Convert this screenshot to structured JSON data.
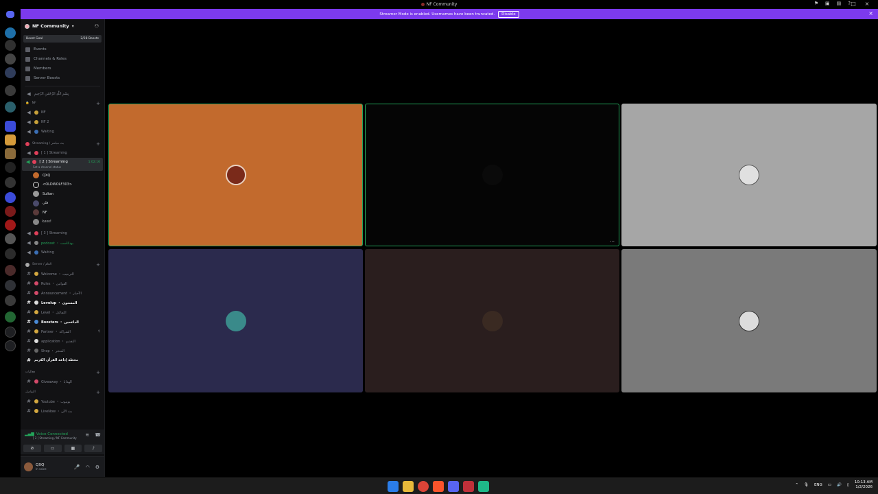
{
  "window": {
    "title": "NF Community"
  },
  "banner": {
    "message": "Streamer Mode is enabled. Usernames have been truncated.",
    "disable_label": "Disable"
  },
  "server": {
    "name": "NF Community",
    "boost_goal": "Boost Goal",
    "boost_count": "2/28 Boosts"
  },
  "menu": [
    "Events",
    "Channels & Roles",
    "Members",
    "Server Boosts"
  ],
  "channels": {
    "top_channel": "بِسْمِ اللَّهِ الرَّحْمَٰنِ الرَّحِيمِ",
    "cat_nf": "NF",
    "nf": "NF",
    "nf2": "NF 2",
    "waiting1": "Waiting",
    "cat_streaming": "Streaming / بث مباشر",
    "streaming1": "[ 1 ] Streaming",
    "streaming2": "[ 2 ] Streaming",
    "streaming2_timer": "1:02:16",
    "streaming2_status": "Set a channel status",
    "streaming3": "[ 3 ] Streaming",
    "podcast": "podcast ・ بودكاست",
    "waiting2": "Waiting",
    "cat_server": "Server / العام",
    "welcome": "Welcome ・ الترحيب",
    "rules": "Rules ・ القوانين",
    "announcement": "Announcement ・ الأخبار",
    "levelup": "Levelup ・ المستوى",
    "level": "Level ・ التفاعل",
    "boosters": "Boosters ・ الداعمين",
    "partner": "Partner ・ الشراكة",
    "application": "application ・ التقديم",
    "shop": "Shop ・ المتجر",
    "quran": "محطة إذاعة القرآن الكريم",
    "cat_events": "فعاليات",
    "giveaway": "Giveaway ・ الهدايا",
    "cat_social": "التواصل",
    "youtube": "Youtube ・ يوتيوب",
    "livenow": "LiveNow ・ بث الآن"
  },
  "members": [
    "QXQ",
    "<OLDWOLF303>",
    "Sultan",
    "فلي",
    "NF",
    "Łεεε!"
  ],
  "voice": {
    "status": "Voice Connected",
    "location": "[ 2 ] Streaming / NF Community"
  },
  "user": {
    "name": "QXQ",
    "status": "In voice"
  },
  "taskbar": {
    "lang": "ENG",
    "time": "10:13 AM",
    "date": "1/2/2026"
  },
  "colors": {
    "tile_orange": "#c26a2d",
    "tile_black": "#050505",
    "tile_gray_light": "#a6a6a6",
    "tile_navy": "#2b2a4d",
    "tile_brown": "#2a1e1e",
    "tile_gray": "#7a7a7a",
    "speaking_border": "#23a55a",
    "banner": "#7c3aed"
  }
}
